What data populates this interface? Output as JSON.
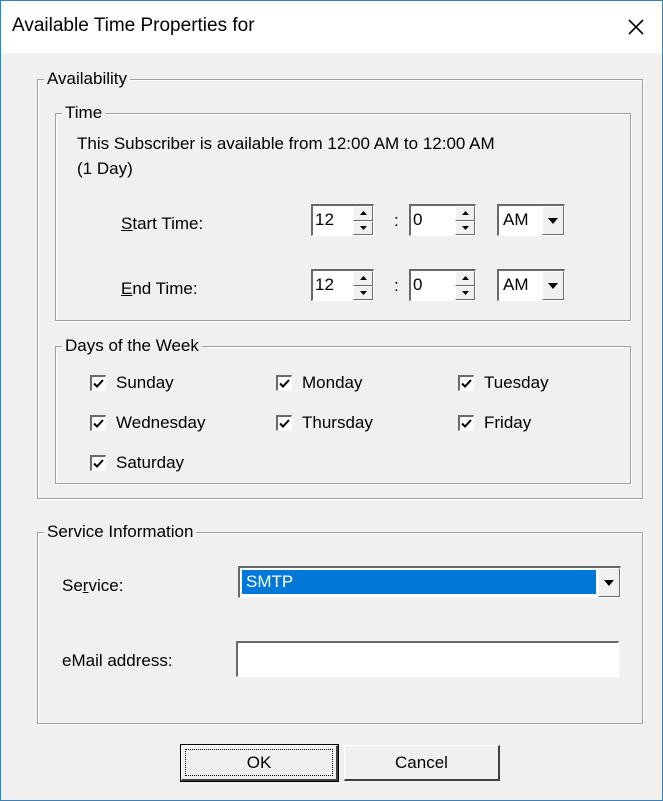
{
  "window": {
    "title": "Available Time Properties for",
    "close_icon": "close-icon"
  },
  "availability": {
    "label": "Availability",
    "time": {
      "label": "Time",
      "summary_line1": "This Subscriber is available from 12:00 AM to 12:00 AM",
      "summary_line2": "(1 Day)",
      "start": {
        "label_accel": "S",
        "label_rest": "tart Time:",
        "hour": "12",
        "minute": "0",
        "separator": ":",
        "ampm": "AM"
      },
      "end": {
        "label_accel": "E",
        "label_rest": "nd Time:",
        "hour": "12",
        "minute": "0",
        "separator": ":",
        "ampm": "AM"
      }
    },
    "days": {
      "label": "Days of the Week",
      "items": [
        {
          "name": "Sunday",
          "checked": true
        },
        {
          "name": "Monday",
          "checked": true
        },
        {
          "name": "Tuesday",
          "checked": true
        },
        {
          "name": "Wednesday",
          "checked": true
        },
        {
          "name": "Thursday",
          "checked": true
        },
        {
          "name": "Friday",
          "checked": true
        },
        {
          "name": "Saturday",
          "checked": true
        }
      ]
    }
  },
  "service_info": {
    "label": "Service Information",
    "service_label_pre": "Se",
    "service_label_accel": "r",
    "service_label_post": "vice:",
    "service_value": "SMTP",
    "email_label": "eMail address:",
    "email_value": ""
  },
  "buttons": {
    "ok": "OK",
    "cancel": "Cancel"
  },
  "colors": {
    "selection": "#0078d7",
    "selection_text": "#ffffff",
    "window_border": "#3c7fb1"
  }
}
